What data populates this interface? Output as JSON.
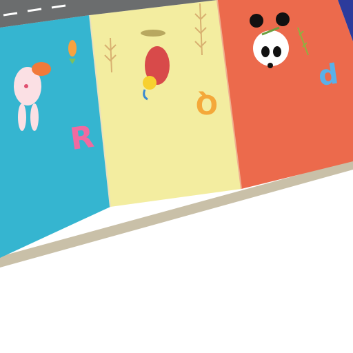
{
  "scene": {
    "subject": "play mat",
    "letters": [
      "R",
      "Q",
      "d"
    ],
    "colors": {
      "road": "#6b6d6e",
      "blue_panel": "#35b5d0",
      "yellow_panel": "#f3eda0",
      "red_panel": "#ec6a4c",
      "navy_panel": "#2c3b9c",
      "background": "#ffffff"
    }
  }
}
